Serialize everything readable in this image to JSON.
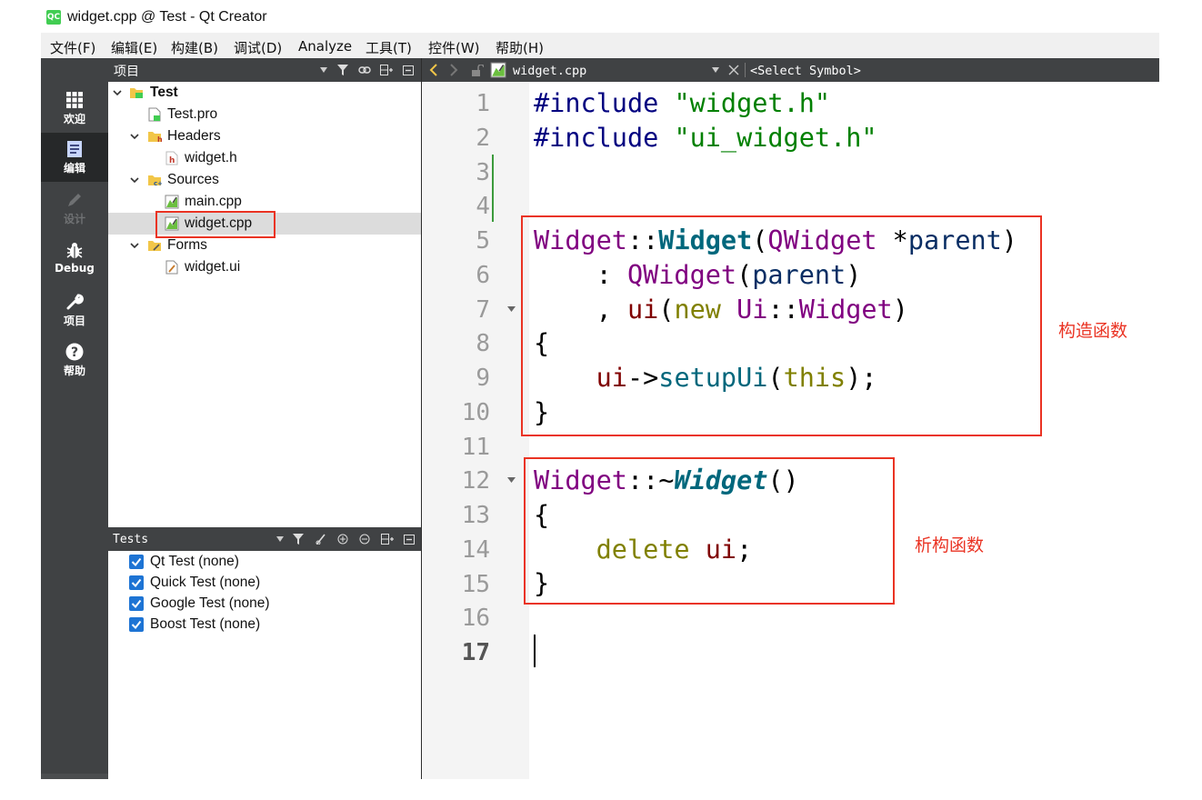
{
  "window": {
    "title": "widget.cpp @ Test - Qt Creator",
    "app_icon": "qt-creator-icon",
    "app_icon_text": "QC"
  },
  "menu": [
    "文件(F)",
    "编辑(E)",
    "构建(B)",
    "调试(D)",
    "Analyze",
    "工具(T)",
    "控件(W)",
    "帮助(H)"
  ],
  "modes": [
    {
      "label": "欢迎",
      "icon": "grid-icon"
    },
    {
      "label": "编辑",
      "icon": "document-icon",
      "active": true
    },
    {
      "label": "设计",
      "icon": "pencil-icon",
      "disabled": true
    },
    {
      "label": "Debug",
      "icon": "bug-icon"
    },
    {
      "label": "项目",
      "icon": "wrench-icon"
    },
    {
      "label": "帮助",
      "icon": "help-icon"
    }
  ],
  "project_panel": {
    "title": "项目",
    "tree": [
      {
        "label": "Test",
        "icon": "project-folder-icon",
        "expanded": true
      },
      {
        "label": "Test.pro",
        "icon": "pro-file-icon"
      },
      {
        "label": "Headers",
        "icon": "headers-folder-icon",
        "expanded": true
      },
      {
        "label": "widget.h",
        "icon": "header-file-icon"
      },
      {
        "label": "Sources",
        "icon": "sources-folder-icon",
        "expanded": true
      },
      {
        "label": "main.cpp",
        "icon": "cpp-file-icon"
      },
      {
        "label": "widget.cpp",
        "icon": "cpp-file-icon",
        "selected": true
      },
      {
        "label": "Forms",
        "icon": "forms-folder-icon",
        "expanded": true
      },
      {
        "label": "widget.ui",
        "icon": "ui-file-icon"
      }
    ]
  },
  "tests_panel": {
    "title": "Tests",
    "items": [
      {
        "label": "Qt Test (none)",
        "checked": true
      },
      {
        "label": "Quick Test (none)",
        "checked": true
      },
      {
        "label": "Google Test (none)",
        "checked": true
      },
      {
        "label": "Boost Test (none)",
        "checked": true
      }
    ]
  },
  "editor": {
    "filename": "widget.cpp",
    "symbol": "<Select Symbol>",
    "current_line": 17,
    "line_numbers": [
      "1",
      "2",
      "3",
      "4",
      "5",
      "6",
      "7",
      "8",
      "9",
      "10",
      "11",
      "12",
      "13",
      "14",
      "15",
      "16",
      "17"
    ],
    "code": {
      "l1": {
        "kw": "#include",
        "str": "\"widget.h\""
      },
      "l2": {
        "kw": "#include",
        "str": "\"ui_widget.h\""
      },
      "l5": {
        "a": "Widget",
        "b": "::",
        "c": "Widget",
        "d": "(",
        "e": "QWidget",
        "f": " *",
        "g": "parent",
        "h": ")"
      },
      "l6": {
        "a": "    : ",
        "b": "QWidget",
        "c": "(",
        "d": "parent",
        "e": ")"
      },
      "l7": {
        "a": "    , ",
        "b": "ui",
        "c": "(",
        "d": "new",
        "e": " ",
        "f": "Ui",
        "g": "::",
        "h": "Widget",
        "i": ")"
      },
      "l8": "{",
      "l9": {
        "a": "    ",
        "b": "ui",
        "c": "->",
        "d": "setupUi",
        "e": "(",
        "f": "this",
        "g": ");"
      },
      "l10": "}",
      "l12": {
        "a": "Widget",
        "b": "::~",
        "c": "Widget",
        "d": "()"
      },
      "l13": "{",
      "l14": {
        "a": "    ",
        "b": "delete",
        "c": " ",
        "d": "ui",
        "e": ";"
      },
      "l15": "}"
    }
  },
  "annotations": {
    "constructor": "构造函数",
    "destructor": "析构函数",
    "color": "#ea3323"
  }
}
